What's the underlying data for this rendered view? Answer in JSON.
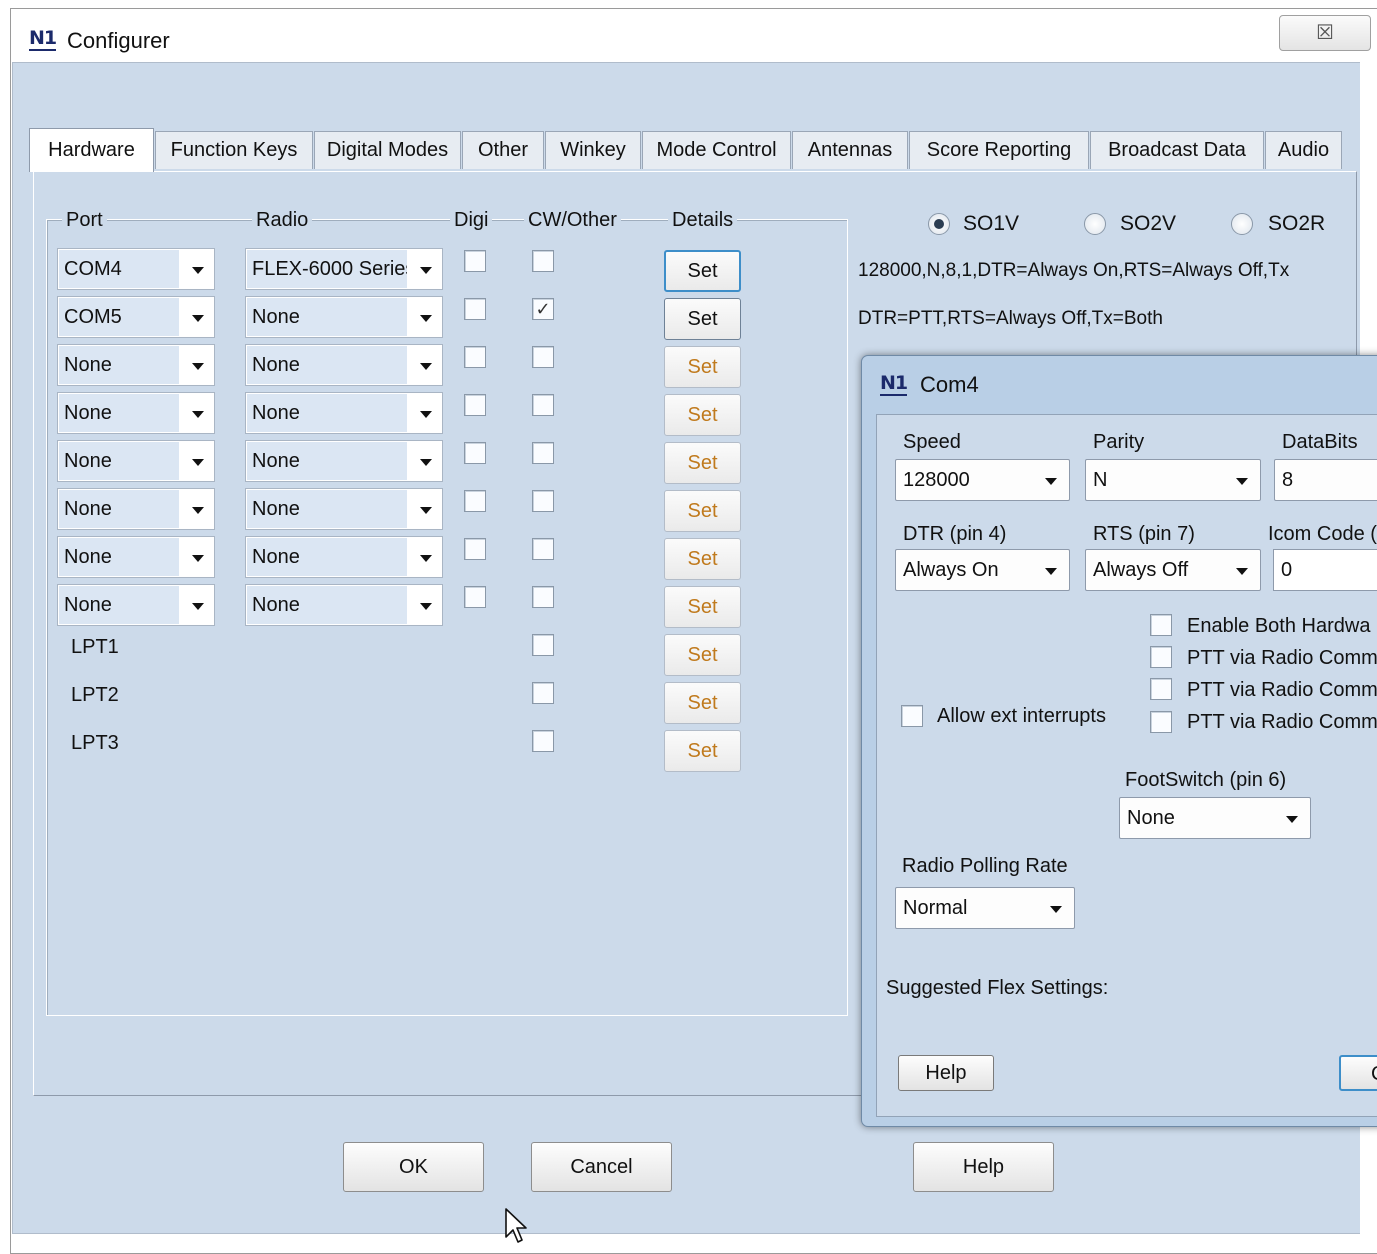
{
  "window": {
    "title": "Configurer",
    "logo": "N1",
    "close_glyph": "☒"
  },
  "tabs": [
    "Hardware",
    "Function Keys",
    "Digital Modes",
    "Other",
    "Winkey",
    "Mode Control",
    "Antennas",
    "Score Reporting",
    "Broadcast Data",
    "Audio"
  ],
  "active_tab": "Hardware",
  "headers": {
    "port": "Port",
    "radio": "Radio",
    "digi": "Digi",
    "cw": "CW/Other",
    "details": "Details"
  },
  "rows": [
    {
      "port": "COM4",
      "radio": "FLEX-6000 Series",
      "digi": false,
      "cw": false,
      "set": "Set"
    },
    {
      "port": "COM5",
      "radio": "None",
      "digi": false,
      "cw": true,
      "set": "Set"
    },
    {
      "port": "None",
      "radio": "None",
      "digi": false,
      "cw": false,
      "set": "Set"
    },
    {
      "port": "None",
      "radio": "None",
      "digi": false,
      "cw": false,
      "set": "Set"
    },
    {
      "port": "None",
      "radio": "None",
      "digi": false,
      "cw": false,
      "set": "Set"
    },
    {
      "port": "None",
      "radio": "None",
      "digi": false,
      "cw": false,
      "set": "Set"
    },
    {
      "port": "None",
      "radio": "None",
      "digi": false,
      "cw": false,
      "set": "Set"
    },
    {
      "port": "None",
      "radio": "None",
      "digi": false,
      "cw": false,
      "set": "Set"
    }
  ],
  "lpt_rows": [
    {
      "label": "LPT1",
      "cw": false,
      "set": "Set"
    },
    {
      "label": "LPT2",
      "cw": false,
      "set": "Set"
    },
    {
      "label": "LPT3",
      "cw": false,
      "set": "Set"
    }
  ],
  "radios": {
    "so1v": "SO1V",
    "so2v": "SO2V",
    "so2r": "SO2R",
    "selected": "SO1V"
  },
  "info": {
    "line1": "128000,N,8,1,DTR=Always On,RTS=Always Off,Tx",
    "line2": "DTR=PTT,RTS=Always Off,Tx=Both"
  },
  "buttons": {
    "ok": "OK",
    "cancel": "Cancel",
    "help": "Help"
  },
  "com4": {
    "title": "Com4",
    "speed_label": "Speed",
    "speed": "128000",
    "parity_label": "Parity",
    "parity": "N",
    "databits_label": "DataBits",
    "databits": "8",
    "dtr_label": "DTR (pin 4)",
    "dtr": "Always On",
    "rts_label": "RTS (pin 7)",
    "rts": "Always Off",
    "icom_label": "Icom Code (",
    "icom": "0",
    "opt_enable_both": "Enable Both Hardwa",
    "opt_ptt1": "PTT via Radio Comm",
    "opt_ptt2": "PTT via Radio Comm",
    "opt_ptt3": "PTT via Radio Comm",
    "allow_ext": "Allow ext interrupts",
    "footswitch_label": "FootSwitch (pin 6)",
    "footswitch": "None",
    "polling_label": "Radio Polling Rate",
    "polling": "Normal",
    "suggested": "Suggested Flex Settings:",
    "help": "Help",
    "ok_partial": "C"
  }
}
